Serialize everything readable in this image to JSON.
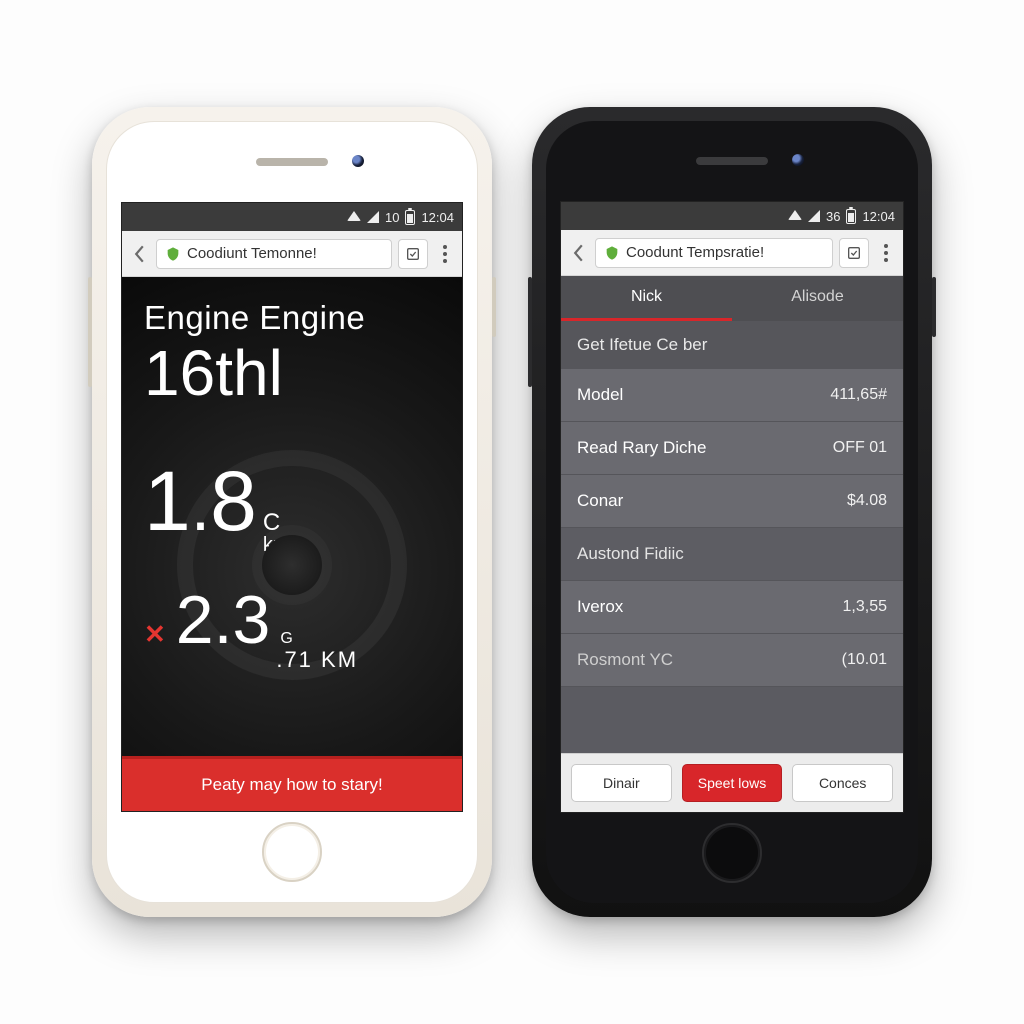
{
  "status": {
    "pct_left": "10",
    "pct_right": "36",
    "time": "12:04"
  },
  "chrome": {
    "title_left": "Coodiunt Temonne!",
    "title_right": "Coodunt Tempsratie!"
  },
  "dash": {
    "title": "Engine Engine",
    "v1_value": "16",
    "v1_unit": "thl",
    "v2_int": "1",
    "v2_dec": "8",
    "v2_unit_top": "C",
    "v2_unit_bot": "km",
    "v3_value": "2.3",
    "v3_unit_top": "G",
    "v3_sub": ".71 KM",
    "cta": "Peaty may how to stary!"
  },
  "tabs": {
    "left": "Nick",
    "right": "Alisode"
  },
  "list": {
    "header1": "Get Ifetue Ce ber",
    "rows1": [
      {
        "label": "Model",
        "value": "411,65#"
      },
      {
        "label": "Read Rary Diche",
        "value": "OFF 01"
      },
      {
        "label": "Conar",
        "value": "$4.08"
      }
    ],
    "header2": "Austond Fidiic",
    "rows2": [
      {
        "label": "Iverox",
        "value": "1,3,55"
      },
      {
        "label": "Rosmont YC",
        "value": "(10.01"
      }
    ]
  },
  "buttons": {
    "left": "Dinair",
    "mid": "Speet lows",
    "right": "Conces"
  }
}
